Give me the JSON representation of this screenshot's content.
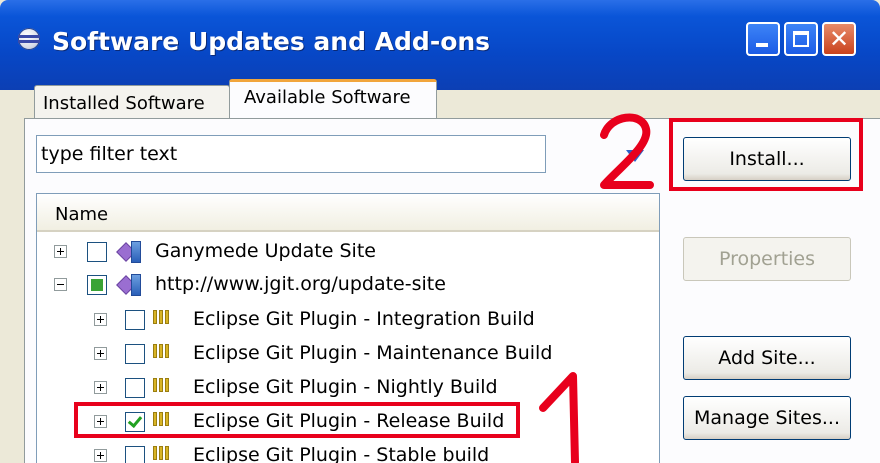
{
  "window": {
    "title": "Software Updates and Add-ons"
  },
  "tabs": [
    {
      "label": "Installed Software"
    },
    {
      "label": "Available Software",
      "selected": true
    }
  ],
  "filter": {
    "value": "type filter text"
  },
  "tree": {
    "column_header": "Name",
    "rows": [
      {
        "label": "Ganymede Update Site",
        "expander": "plus",
        "check": "unchecked",
        "icon": "update-site-icon"
      },
      {
        "label": "http://www.jgit.org/update-site",
        "expander": "minus",
        "check": "partial",
        "icon": "update-site-icon"
      },
      {
        "label": "Eclipse Git Plugin - Integration Build",
        "expander": "plus",
        "check": "unchecked",
        "icon": "feature-icon"
      },
      {
        "label": "Eclipse Git Plugin - Maintenance Build",
        "expander": "plus",
        "check": "unchecked",
        "icon": "feature-icon"
      },
      {
        "label": "Eclipse Git Plugin - Nightly Build",
        "expander": "plus",
        "check": "unchecked",
        "icon": "feature-icon"
      },
      {
        "label": "Eclipse Git Plugin - Release Build",
        "expander": "plus",
        "check": "checked",
        "icon": "feature-icon"
      },
      {
        "label": "Eclipse Git Plugin - Stable build",
        "expander": "plus",
        "check": "unchecked",
        "icon": "feature-icon"
      }
    ]
  },
  "buttons": {
    "install": "Install...",
    "properties": "Properties",
    "add_site": "Add Site...",
    "manage_sites": "Manage Sites..."
  },
  "annotations": {
    "step_one": "1",
    "step_two": "2",
    "color": "#e8001c"
  }
}
